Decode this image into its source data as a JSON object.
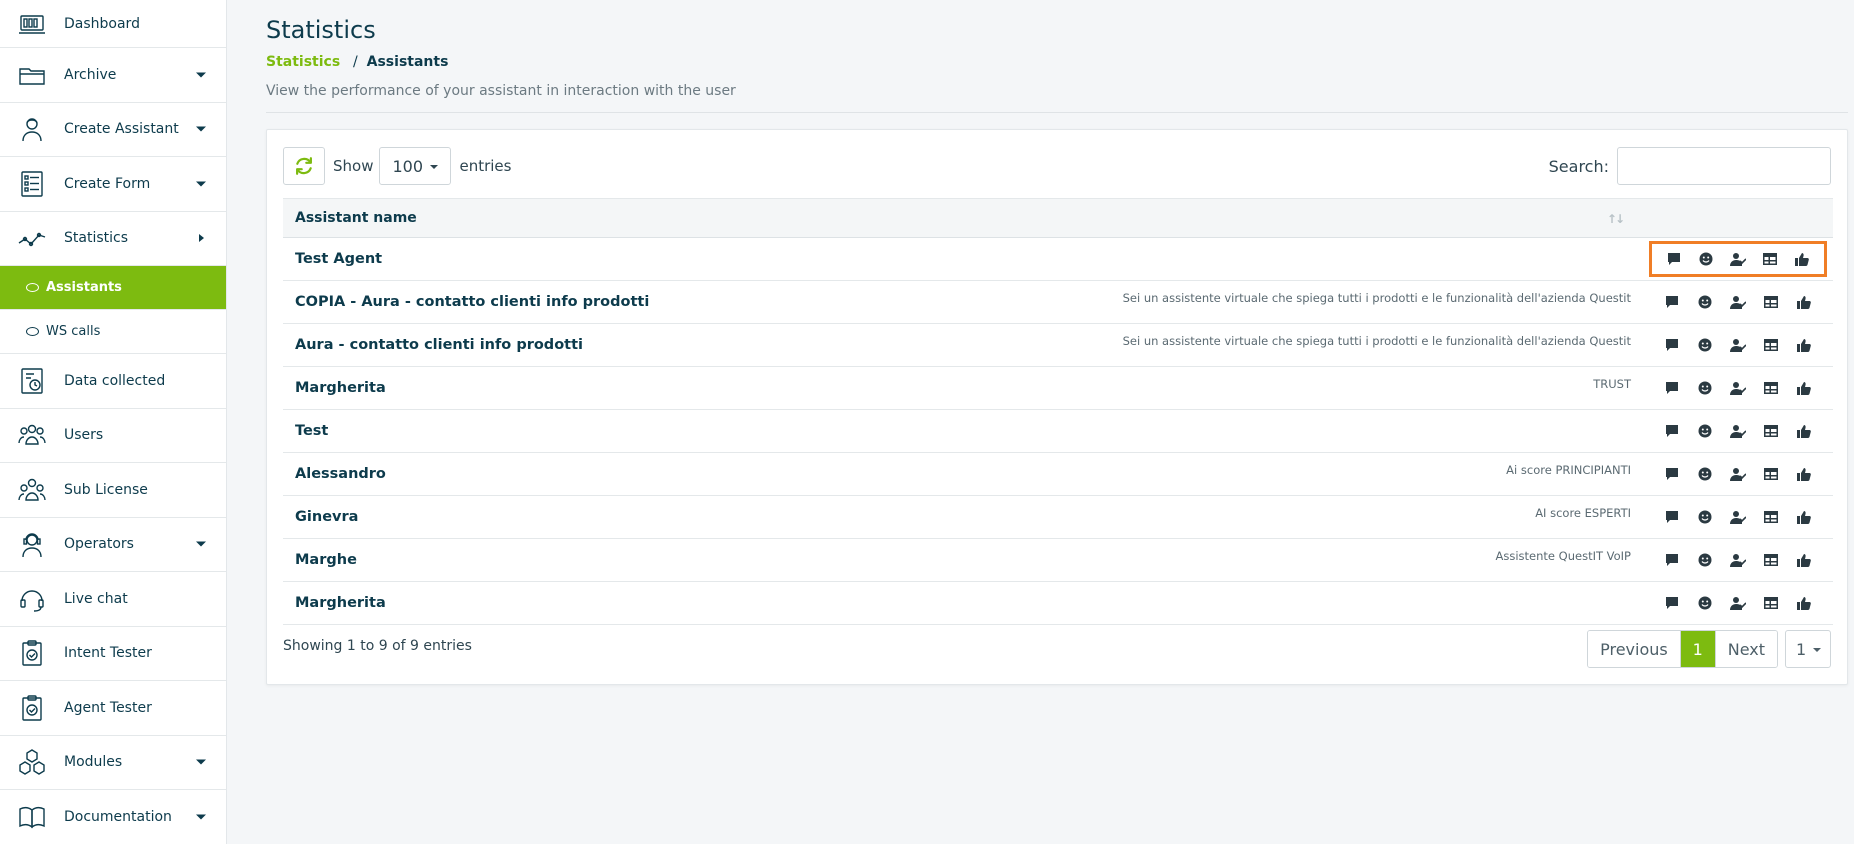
{
  "sidebar": {
    "items": [
      {
        "label": "Dashboard",
        "icon": "dashboard-icon",
        "caret": "none"
      },
      {
        "label": "Archive",
        "icon": "folder-icon",
        "caret": "down"
      },
      {
        "label": "Create Assistant",
        "icon": "assistant-icon",
        "caret": "down"
      },
      {
        "label": "Create Form",
        "icon": "form-icon",
        "caret": "down"
      },
      {
        "label": "Statistics",
        "icon": "statistics-icon",
        "caret": "right"
      },
      {
        "label": "Data collected",
        "icon": "data-collected-icon",
        "caret": "none"
      },
      {
        "label": "Users",
        "icon": "users-icon",
        "caret": "none"
      },
      {
        "label": "Sub License",
        "icon": "sub-license-icon",
        "caret": "none"
      },
      {
        "label": "Operators",
        "icon": "operators-icon",
        "caret": "down"
      },
      {
        "label": "Live chat",
        "icon": "headset-icon",
        "caret": "none"
      },
      {
        "label": "Intent Tester",
        "icon": "clipboard-check-icon",
        "caret": "none"
      },
      {
        "label": "Agent Tester",
        "icon": "clipboard-check-icon",
        "caret": "none"
      },
      {
        "label": "Modules",
        "icon": "modules-icon",
        "caret": "down"
      },
      {
        "label": "Documentation",
        "icon": "book-icon",
        "caret": "down"
      }
    ],
    "submenu": [
      {
        "label": "Assistants",
        "active": true
      },
      {
        "label": "WS calls",
        "active": false
      }
    ]
  },
  "header": {
    "title": "Statistics",
    "breadcrumb": {
      "link": "Statistics",
      "separator": "/",
      "current": "Assistants"
    },
    "description": "View the performance of your assistant in interaction with the user"
  },
  "toolbar": {
    "show_label": "Show",
    "entries_value": "100",
    "entries_label": "entries",
    "search_label": "Search:",
    "search_value": ""
  },
  "table": {
    "column": "Assistant name",
    "sort_icon": "↑↓",
    "rows": [
      {
        "name": "Test Agent",
        "desc": ""
      },
      {
        "name": "COPIA - Aura - contatto clienti info prodotti",
        "desc": "Sei un assistente virtuale che spiega tutti i prodotti e le funzionalità dell'azienda Questit"
      },
      {
        "name": "Aura - contatto clienti info prodotti",
        "desc": "Sei un assistente virtuale che spiega tutti i prodotti e le funzionalità dell'azienda Questit"
      },
      {
        "name": "Margherita",
        "desc": "TRUST"
      },
      {
        "name": "Test",
        "desc": ""
      },
      {
        "name": "Alessandro",
        "desc": "Ai score PRINCIPIANTI"
      },
      {
        "name": "Ginevra",
        "desc": "AI score ESPERTI"
      },
      {
        "name": "Marghe",
        "desc": "Assistente QuestIT VoIP"
      },
      {
        "name": "Margherita",
        "desc": ""
      }
    ],
    "action_icons": [
      "chat-bubble-icon",
      "smiley-icon",
      "user-check-icon",
      "table-icon",
      "thumbs-up-icon"
    ]
  },
  "footer": {
    "info": "Showing 1 to 9 of 9 entries",
    "previous": "Previous",
    "current_page": "1",
    "next": "Next",
    "page_select": "1"
  },
  "colors": {
    "accent": "#7dbb10",
    "text": "#0d3b4c",
    "highlight": "#f07e26"
  }
}
